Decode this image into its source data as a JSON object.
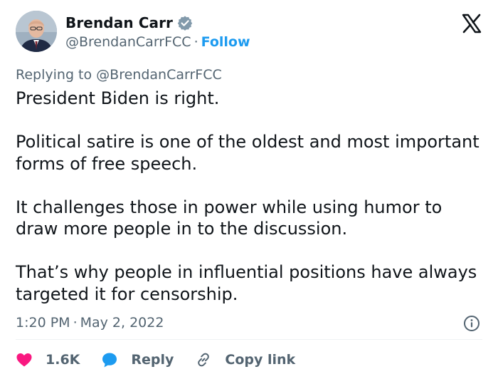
{
  "author": {
    "display_name": "Brendan Carr",
    "handle": "@BrendanCarrFCC",
    "separator": "·",
    "follow_label": "Follow",
    "verified_color": "#829aab"
  },
  "brand": {
    "logo": "x-logo-icon"
  },
  "reply_context": {
    "prefix": "Replying to",
    "mention": "@BrendanCarrFCC"
  },
  "tweet": {
    "paragraphs": [
      "President Biden is right.",
      "Political satire is one of the oldest and most important forms of free speech.",
      "It challenges those in power while using humor to draw more people in to the discussion.",
      "That’s why people in influential positions have always targeted it for censorship."
    ],
    "time": "1:20 PM",
    "separator": "·",
    "date": "May 2, 2022"
  },
  "actions": {
    "likes": {
      "icon": "heart-icon",
      "count": "1.6K",
      "color": "#f91880"
    },
    "reply": {
      "icon": "reply-bubble-icon",
      "label": "Reply",
      "color": "#1d9bf0"
    },
    "copy_link": {
      "icon": "link-icon",
      "label": "Copy link"
    }
  },
  "colors": {
    "accent": "#1d9bf0",
    "secondary_text": "#536471",
    "primary_text": "#0f1419"
  }
}
